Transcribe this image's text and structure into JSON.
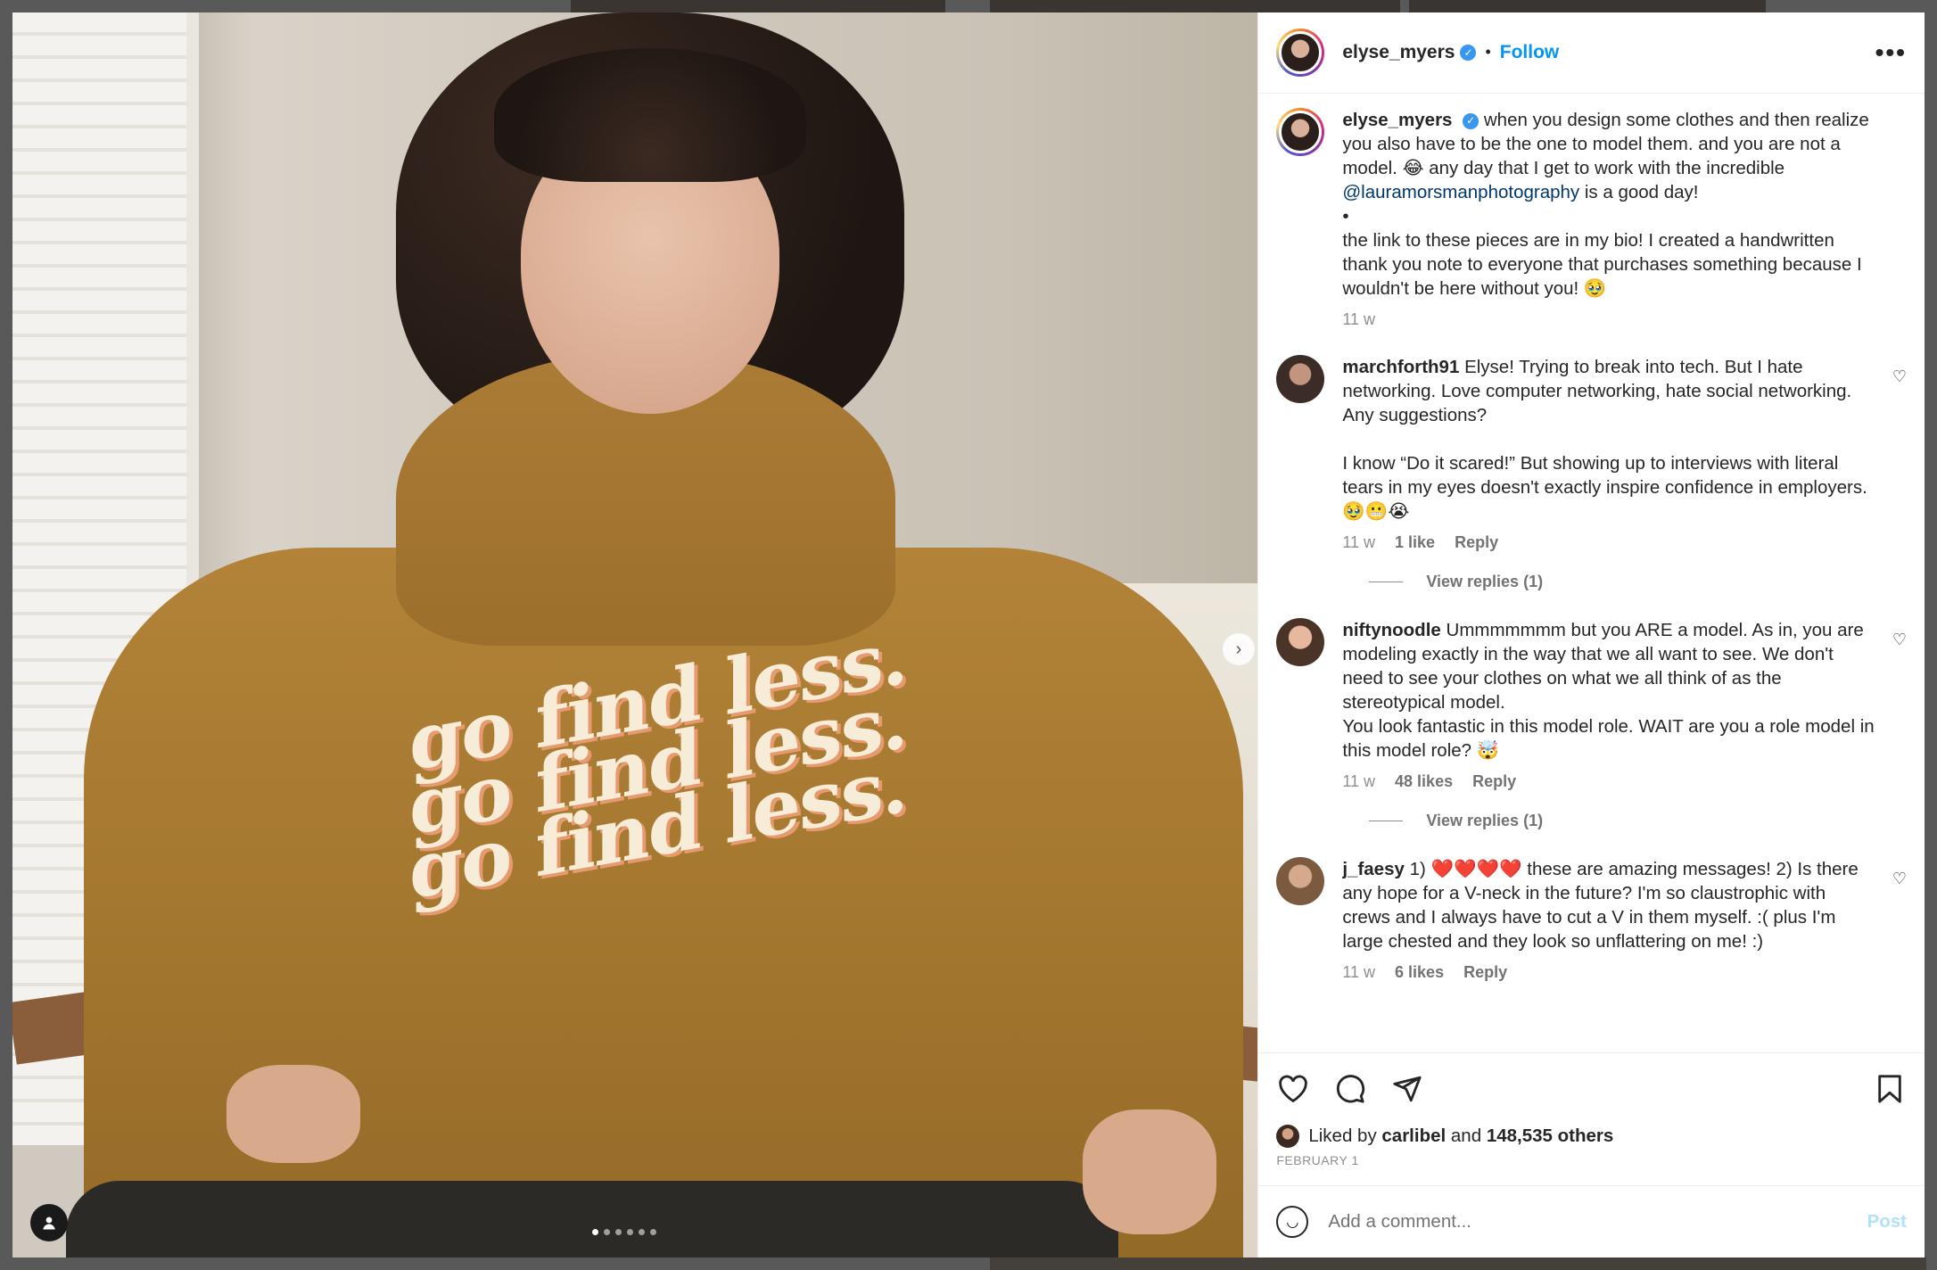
{
  "post": {
    "author": "elyse_myers",
    "follow_label": "Follow",
    "more_label": "•••",
    "caption_lines": [
      "when you design some clothes and then realize you also have to be the one to model them. and you are not a model. 😂 any day that I get to work with the incredible ",
      "@lauramorsmanphotography",
      " is a good day!",
      "•",
      "the link to these pieces are in my bio! I created a handwritten thank you note to everyone that purchases something because I wouldn't be here without you! 🥹"
    ],
    "caption_time": "11 w",
    "shirt_text": [
      "go find less.",
      "go find less.",
      "go find less."
    ]
  },
  "comments": [
    {
      "user": "marchforth91",
      "text_1": "Elyse! Trying to break into tech. But I hate networking. Love computer networking, hate social networking. Any suggestions?",
      "text_2": "I know “Do it scared!” But showing up to interviews with literal tears in my eyes doesn't exactly inspire confidence in employers. 🥹😬😭",
      "time": "11 w",
      "likes": "1 like",
      "reply": "Reply",
      "view_replies": "View replies (1)"
    },
    {
      "user": "niftynoodle",
      "text_1": "Ummmmmmm but you ARE a model. As in, you are modeling exactly in the way that we all want to see. We don't need to see your clothes on what we all think of as the stereotypical model.",
      "text_2": "You look fantastic in this model role. WAIT are you a role model in this model role? 🤯",
      "time": "11 w",
      "likes": "48 likes",
      "reply": "Reply",
      "view_replies": "View replies (1)"
    },
    {
      "user": "j_faesy",
      "text_1": "1) ❤️❤️❤️❤️ these are amazing messages! 2) Is there any hope for a V-neck in the future? I'm so claustrophic with crews and I always have to cut a V in them myself. :( plus I'm large chested and they look so unflattering on me! :)",
      "time": "11 w",
      "likes": "6 likes",
      "reply": "Reply"
    }
  ],
  "likes": {
    "prefix": "Liked by ",
    "user": "carlibel",
    "middle": " and ",
    "count": "148,535 others"
  },
  "date": "FEBRUARY 1",
  "comment_input": {
    "placeholder": "Add a comment...",
    "post_label": "Post"
  },
  "carousel": {
    "count": 6,
    "active_index": 0
  },
  "colors": {
    "accent": "#0095f6",
    "verified": "#3897f0",
    "post_disabled": "#b2dffc"
  }
}
